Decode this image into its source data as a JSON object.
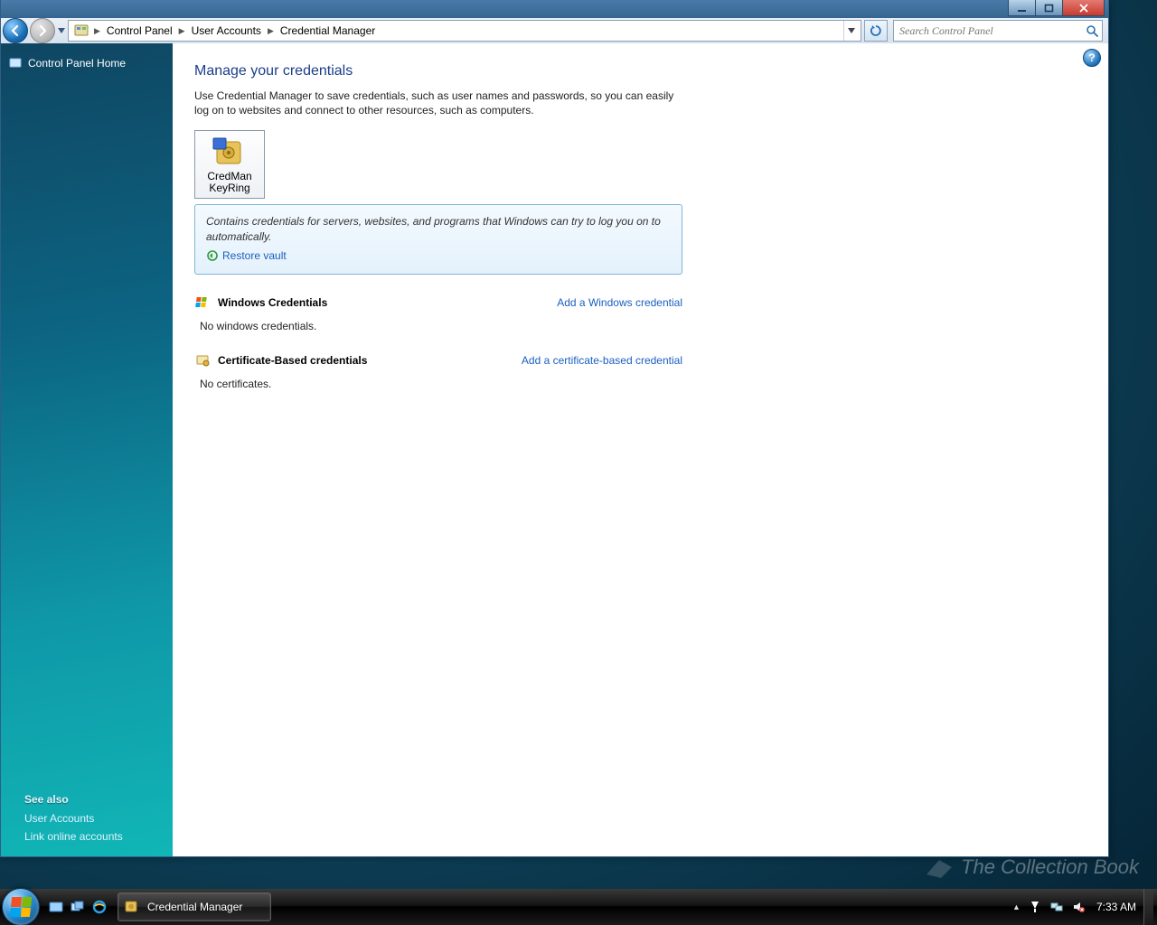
{
  "breadcrumbs": [
    "Control Panel",
    "User Accounts",
    "Credential Manager"
  ],
  "search_placeholder": "Search Control Panel",
  "sidebar": {
    "home": "Control Panel Home",
    "see_also": "See also",
    "links": [
      "User Accounts",
      "Link online accounts"
    ]
  },
  "page": {
    "title": "Manage your credentials",
    "description": "Use Credential Manager to save credentials, such as user names and passwords, so you can easily log on to websites and connect to other resources, such as computers.",
    "vault_name": "CredMan KeyRing",
    "vault_info": "Contains credentials for servers, websites, and programs that Windows can try to log you on to automatically.",
    "restore_link": "Restore vault",
    "sections": [
      {
        "title": "Windows Credentials",
        "add": "Add a Windows credential",
        "empty": "No windows credentials."
      },
      {
        "title": "Certificate-Based credentials",
        "add": "Add a certificate-based credential",
        "empty": "No certificates."
      }
    ]
  },
  "taskbar": {
    "active_task": "Credential Manager",
    "clock": "7:33 AM"
  },
  "watermark": "The Collection Book"
}
